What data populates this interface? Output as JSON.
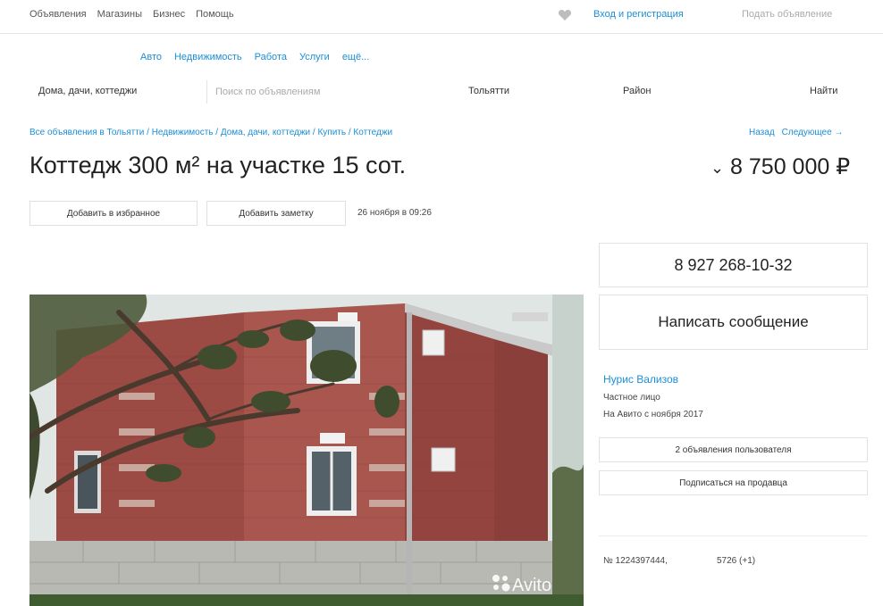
{
  "topnav": {
    "items": [
      "Объявления",
      "Магазины",
      "Бизнес",
      "Помощь"
    ],
    "login": "Вход и регистрация",
    "post_ad": "Подать объявление"
  },
  "catnav": {
    "items": [
      "Авто",
      "Недвижимость",
      "Работа",
      "Услуги",
      "ещё..."
    ]
  },
  "search": {
    "category": "Дома, дачи, коттеджи",
    "placeholder": "Поиск по объявлениям",
    "city": "Тольятти",
    "district": "Район",
    "button": "Найти"
  },
  "breadcrumb": "Все объявления в Тольятти / Недвижимость / Дома, дачи, коттеджи / Купить / Коттеджи",
  "pager": {
    "back": "Назад",
    "next": "Следующее →"
  },
  "listing": {
    "title": "Коттедж 300 м² на участке 15 сот.",
    "price": "8 750 000 ₽",
    "price_prefix": "⌄",
    "fav_button": "Добавить в избранное",
    "note_button": "Добавить заметку",
    "date": "26 ноября в 09:26",
    "photo_watermark": "Avito"
  },
  "contact": {
    "phone": "8 927 268-10-32",
    "message_button": "Написать сообщение"
  },
  "seller": {
    "name": "Нурис Вализов",
    "type": "Частное лицо",
    "since": "На Авито с ноября 2017",
    "ads_button": "2 объявления пользователя",
    "subscribe_button": "Подписаться на продавца"
  },
  "meta": {
    "ad_number": "№ 1224397444,",
    "views": "5726 (+1)"
  },
  "colors": {
    "link": "#1a8fd8",
    "brick": "#a4504a",
    "stone": "#b9b9b4"
  }
}
